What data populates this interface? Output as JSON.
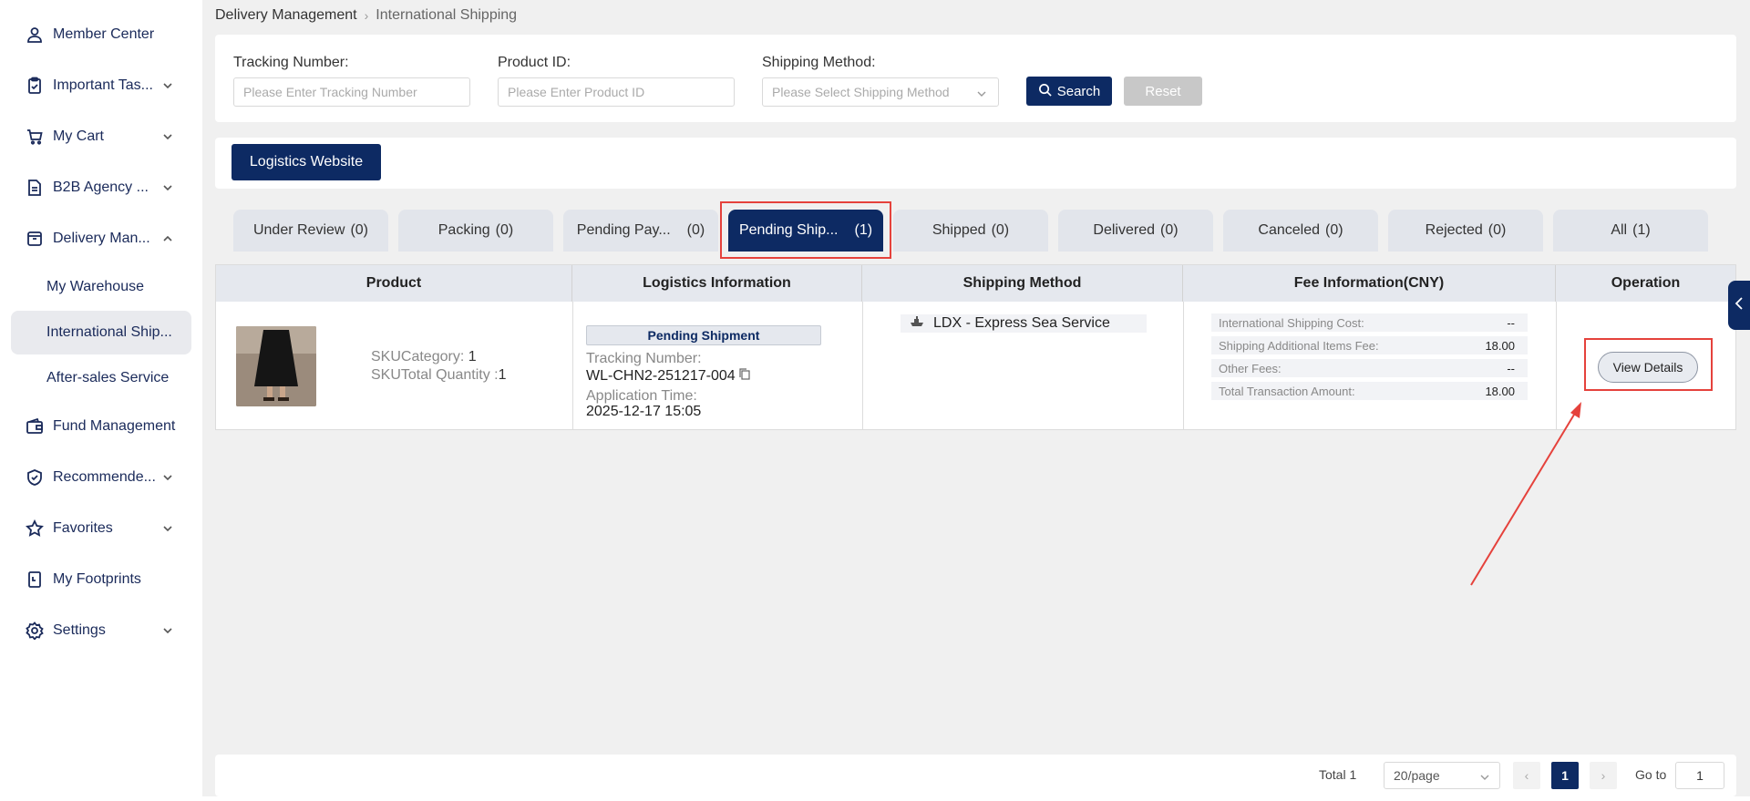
{
  "sidebar": {
    "items": [
      {
        "label": "Member Center",
        "icon": "user-icon",
        "chevron": ""
      },
      {
        "label": "Important Tas...",
        "icon": "clipboard-check-icon",
        "chevron": "down"
      },
      {
        "label": "My Cart",
        "icon": "cart-icon",
        "chevron": "down"
      },
      {
        "label": "B2B Agency ...",
        "icon": "document-icon",
        "chevron": "down"
      },
      {
        "label": "Delivery Man...",
        "icon": "box-icon",
        "chevron": "up"
      },
      {
        "label": "Fund Management",
        "icon": "wallet-icon",
        "chevron": ""
      },
      {
        "label": "Recommende...",
        "icon": "badge-icon",
        "chevron": "down"
      },
      {
        "label": "Favorites",
        "icon": "star-icon",
        "chevron": "down"
      },
      {
        "label": "My Footprints",
        "icon": "footprint-doc-icon",
        "chevron": ""
      },
      {
        "label": "Settings",
        "icon": "gear-icon",
        "chevron": "down"
      }
    ],
    "sub_items": [
      "My Warehouse",
      "International Ship...",
      "After-sales Service"
    ]
  },
  "breadcrumb": {
    "parent": "Delivery Management",
    "separator": "›",
    "current": "International Shipping"
  },
  "search": {
    "tracking_label": "Tracking Number:",
    "tracking_placeholder": "Please Enter Tracking Number",
    "product_label": "Product ID:",
    "product_placeholder": "Please Enter Product ID",
    "method_label": "Shipping Method:",
    "method_placeholder": "Please Select Shipping Method",
    "search_button": "Search",
    "reset_button": "Reset"
  },
  "logistics_button": "Logistics Website",
  "tabs": [
    {
      "label": "Under Review",
      "count": "(0)"
    },
    {
      "label": "Packing",
      "count": "(0)"
    },
    {
      "label": "Pending Pay...",
      "count": "(0)"
    },
    {
      "label": "Pending Ship...",
      "count": "(1)"
    },
    {
      "label": "Shipped",
      "count": "(0)"
    },
    {
      "label": "Delivered",
      "count": "(0)"
    },
    {
      "label": "Canceled",
      "count": "(0)"
    },
    {
      "label": "Rejected",
      "count": "(0)"
    },
    {
      "label": "All",
      "count": "(1)"
    }
  ],
  "table": {
    "headers": [
      "Product",
      "Logistics Information",
      "Shipping Method",
      "Fee Information(CNY)",
      "Operation"
    ],
    "row": {
      "sku_category_label": "SKUCategory:",
      "sku_category_value": "1",
      "sku_qty_label": "SKUTotal Quantity :",
      "sku_qty_value": "1",
      "status_badge": "Pending Shipment",
      "tracking_label": "Tracking Number:",
      "tracking_value": "WL-CHN2-251217-004",
      "app_time_label": "Application Time:",
      "app_time_value": "2025-12-17 15:05",
      "shipping_method": "LDX - Express Sea Service",
      "fees": [
        {
          "label": "International Shipping Cost:",
          "value": "--"
        },
        {
          "label": "Shipping Additional Items Fee:",
          "value": "18.00"
        },
        {
          "label": "Other Fees:",
          "value": "--"
        },
        {
          "label": "Total Transaction Amount:",
          "value": "18.00"
        }
      ],
      "view_button": "View Details"
    }
  },
  "pagination": {
    "total": "Total 1",
    "page_size": "20/page",
    "current_page": "1",
    "goto_label": "Go to",
    "goto_value": "1"
  },
  "colors": {
    "primary": "#0d2a63",
    "highlight": "#e5423c"
  }
}
